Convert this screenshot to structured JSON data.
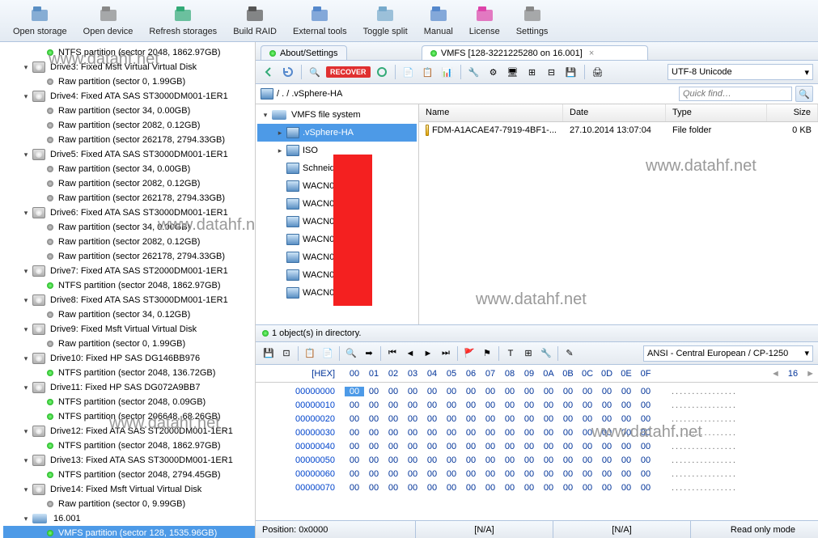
{
  "toolbar": [
    {
      "label": "Open storage",
      "icon": "folder-open"
    },
    {
      "label": "Open device",
      "icon": "device"
    },
    {
      "label": "Refresh storages",
      "icon": "refresh"
    },
    {
      "label": "Build RAID",
      "icon": "raid"
    },
    {
      "label": "External tools",
      "icon": "tools"
    },
    {
      "label": "Toggle split",
      "icon": "split"
    },
    {
      "label": "Manual",
      "icon": "manual"
    },
    {
      "label": "License",
      "icon": "license"
    },
    {
      "label": "Settings",
      "icon": "settings"
    }
  ],
  "tree": [
    {
      "depth": 2,
      "type": "part",
      "dot": "green",
      "label": "NTFS partition (sector 2048, 1862.97GB)"
    },
    {
      "depth": 1,
      "type": "disk",
      "expander": "open",
      "label": "Drive3: Fixed Msft Virtual Virtual Disk"
    },
    {
      "depth": 2,
      "type": "part",
      "dot": "gray",
      "label": "Raw partition (sector 0, 1.99GB)"
    },
    {
      "depth": 1,
      "type": "disk",
      "expander": "open",
      "label": "Drive4: Fixed ATA SAS ST3000DM001-1ER1"
    },
    {
      "depth": 2,
      "type": "part",
      "dot": "gray",
      "label": "Raw partition (sector 34, 0.00GB)"
    },
    {
      "depth": 2,
      "type": "part",
      "dot": "gray",
      "label": "Raw partition (sector 2082, 0.12GB)"
    },
    {
      "depth": 2,
      "type": "part",
      "dot": "gray",
      "label": "Raw partition (sector 262178, 2794.33GB)"
    },
    {
      "depth": 1,
      "type": "disk",
      "expander": "open",
      "label": "Drive5: Fixed ATA SAS ST3000DM001-1ER1"
    },
    {
      "depth": 2,
      "type": "part",
      "dot": "gray",
      "label": "Raw partition (sector 34, 0.00GB)"
    },
    {
      "depth": 2,
      "type": "part",
      "dot": "gray",
      "label": "Raw partition (sector 2082, 0.12GB)"
    },
    {
      "depth": 2,
      "type": "part",
      "dot": "gray",
      "label": "Raw partition (sector 262178, 2794.33GB)"
    },
    {
      "depth": 1,
      "type": "disk",
      "expander": "open",
      "label": "Drive6: Fixed ATA SAS ST3000DM001-1ER1"
    },
    {
      "depth": 2,
      "type": "part",
      "dot": "gray",
      "label": "Raw partition (sector 34, 0.00GB)"
    },
    {
      "depth": 2,
      "type": "part",
      "dot": "gray",
      "label": "Raw partition (sector 2082, 0.12GB)"
    },
    {
      "depth": 2,
      "type": "part",
      "dot": "gray",
      "label": "Raw partition (sector 262178, 2794.33GB)"
    },
    {
      "depth": 1,
      "type": "disk",
      "expander": "open",
      "label": "Drive7: Fixed ATA SAS ST2000DM001-1ER1"
    },
    {
      "depth": 2,
      "type": "part",
      "dot": "green",
      "label": "NTFS partition (sector 2048, 1862.97GB)"
    },
    {
      "depth": 1,
      "type": "disk",
      "expander": "open",
      "label": "Drive8: Fixed ATA SAS ST3000DM001-1ER1"
    },
    {
      "depth": 2,
      "type": "part",
      "dot": "gray",
      "label": "Raw partition (sector 34, 0.12GB)"
    },
    {
      "depth": 1,
      "type": "disk",
      "expander": "open",
      "label": "Drive9: Fixed Msft Virtual Virtual Disk"
    },
    {
      "depth": 2,
      "type": "part",
      "dot": "gray",
      "label": "Raw partition (sector 0, 1.99GB)"
    },
    {
      "depth": 1,
      "type": "disk",
      "expander": "open",
      "label": "Drive10: Fixed HP SAS DG146BB976"
    },
    {
      "depth": 2,
      "type": "part",
      "dot": "green",
      "label": "NTFS partition (sector 2048, 136.72GB)"
    },
    {
      "depth": 1,
      "type": "disk",
      "expander": "open",
      "label": "Drive11: Fixed HP SAS DG072A9BB7"
    },
    {
      "depth": 2,
      "type": "part",
      "dot": "green",
      "label": "NTFS partition (sector 2048, 0.09GB)"
    },
    {
      "depth": 2,
      "type": "part",
      "dot": "green",
      "label": "NTFS partition (sector 206648, 68.26GB)"
    },
    {
      "depth": 1,
      "type": "disk",
      "expander": "open",
      "label": "Drive12: Fixed ATA SAS ST2000DM001-1ER1"
    },
    {
      "depth": 2,
      "type": "part",
      "dot": "green",
      "label": "NTFS partition (sector 2048, 1862.97GB)"
    },
    {
      "depth": 1,
      "type": "disk",
      "expander": "open",
      "label": "Drive13: Fixed ATA SAS ST3000DM001-1ER1"
    },
    {
      "depth": 2,
      "type": "part",
      "dot": "green",
      "label": "NTFS partition (sector 2048, 2794.45GB)"
    },
    {
      "depth": 1,
      "type": "disk",
      "expander": "open",
      "label": "Drive14: Fixed Msft Virtual Virtual Disk"
    },
    {
      "depth": 2,
      "type": "part",
      "dot": "gray",
      "label": "Raw partition (sector 0, 9.99GB)"
    },
    {
      "depth": 1,
      "type": "drive",
      "expander": "open",
      "label": "16.001"
    },
    {
      "depth": 2,
      "type": "part",
      "dot": "green",
      "label": "VMFS partition (sector 128, 1535.96GB)",
      "selected": true
    }
  ],
  "tabs": {
    "t1": "About/Settings",
    "t2": "VMFS [128-3221225280 on 16.001]"
  },
  "breadcrumb": {
    "path": " /  .  /  .vSphere-HA",
    "search_placeholder": "Quick find…"
  },
  "encoding": "UTF-8 Unicode",
  "folder_tree": [
    {
      "depth": 0,
      "expander": "open",
      "icon": "drive",
      "label": "VMFS file system"
    },
    {
      "depth": 1,
      "expander": "closed",
      "icon": "blue",
      "label": ".vSphere-HA",
      "selected": true
    },
    {
      "depth": 1,
      "expander": "closed",
      "icon": "blue",
      "label": "ISO"
    },
    {
      "depth": 1,
      "expander": "none",
      "icon": "blue",
      "label": "Schneide"
    },
    {
      "depth": 1,
      "expander": "none",
      "icon": "blue",
      "label": "WACN00"
    },
    {
      "depth": 1,
      "expander": "none",
      "icon": "blue",
      "label": "WACN00                    01"
    },
    {
      "depth": 1,
      "expander": "none",
      "icon": "blue",
      "label": "WACN00                    02"
    },
    {
      "depth": 1,
      "expander": "none",
      "icon": "blue",
      "label": "WACN00"
    },
    {
      "depth": 1,
      "expander": "none",
      "icon": "blue",
      "label": "WACN00"
    },
    {
      "depth": 1,
      "expander": "none",
      "icon": "blue",
      "label": "WACN00"
    },
    {
      "depth": 1,
      "expander": "none",
      "icon": "blue",
      "label": "WACN00"
    }
  ],
  "file_headers": {
    "name": "Name",
    "date": "Date",
    "type": "Type",
    "size": "Size"
  },
  "files": [
    {
      "name": "FDM-A1ACAE47-7919-4BF1-...",
      "date": "27.10.2014 13:07:04",
      "type": "File folder",
      "size": "0 KB"
    }
  ],
  "status_text": "1 object(s) in directory.",
  "hex_encoding": "ANSI - Central European / CP-1250",
  "hex": {
    "header_label": "[HEX]",
    "cols": [
      "00",
      "01",
      "02",
      "03",
      "04",
      "05",
      "06",
      "07",
      "08",
      "09",
      "0A",
      "0B",
      "0C",
      "0D",
      "0E",
      "0F"
    ],
    "size_label": "16",
    "nav": {
      "left": "◄",
      "right": "►"
    }
  },
  "hex_rows": [
    {
      "offset": "00000000",
      "first_sel": true
    },
    {
      "offset": "00000010"
    },
    {
      "offset": "00000020"
    },
    {
      "offset": "00000030"
    },
    {
      "offset": "00000040"
    },
    {
      "offset": "00000050"
    },
    {
      "offset": "00000060"
    },
    {
      "offset": "00000070"
    }
  ],
  "bottom": {
    "position": "Position: 0x0000",
    "na1": "[N/A]",
    "na2": "[N/A]",
    "mode": "Read only mode"
  },
  "recover": "RECOVER",
  "watermark": "www.datahf.net"
}
